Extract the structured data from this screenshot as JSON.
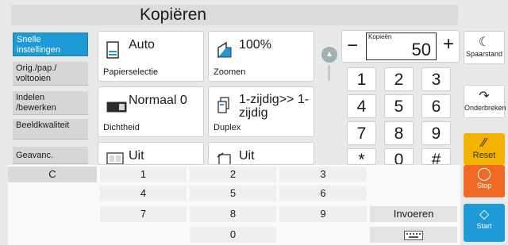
{
  "title": "Kopiëren",
  "tabs": [
    {
      "label": "Snelle instellingen",
      "active": true
    },
    {
      "label": "Orig./pap./ voltooien",
      "active": false
    },
    {
      "label": "Indelen /bewerken",
      "active": false
    },
    {
      "label": "Beeldkwaliteit",
      "active": false
    },
    {
      "label": "Geavanc.",
      "active": false
    }
  ],
  "cards": {
    "paper": {
      "value": "Auto",
      "label": "Papierselectie",
      "icon": "paper-icon"
    },
    "zoom": {
      "value": "100%",
      "label": "Zoomen",
      "icon": "zoom-icon"
    },
    "density": {
      "value": "Normaal 0",
      "label": "Dichtheid",
      "icon": "density-icon"
    },
    "duplex": {
      "value": "1-zijdig>> 1-zijdig",
      "label": "Duplex",
      "icon": "duplex-icon"
    },
    "combine": {
      "value": "Uit",
      "label": "",
      "icon": "combine-icon"
    },
    "staple": {
      "value": "Uit",
      "label": "",
      "icon": "staple-icon"
    }
  },
  "copies": {
    "label": "Kopieën",
    "value": "50",
    "minus": "−",
    "plus": "+"
  },
  "keypad": [
    "1",
    "2",
    "3",
    "4",
    "5",
    "6",
    "7",
    "8",
    "9",
    "*",
    "0",
    "#"
  ],
  "right": {
    "energy_save": "Spaarstand",
    "interrupt": "Onderbreken",
    "reset": "Reset",
    "stop": "Stop",
    "start": "Start"
  },
  "tenkey": {
    "clear": "C",
    "rows": [
      [
        "1",
        "2",
        "3"
      ],
      [
        "4",
        "5",
        "6"
      ],
      [
        "7",
        "8",
        "9"
      ]
    ],
    "zero": "0",
    "enter": "Invoeren"
  },
  "colors": {
    "accent": "#1e9ad6",
    "reset": "#f3b300",
    "stop": "#f06a25",
    "start": "#1e9ad6"
  }
}
